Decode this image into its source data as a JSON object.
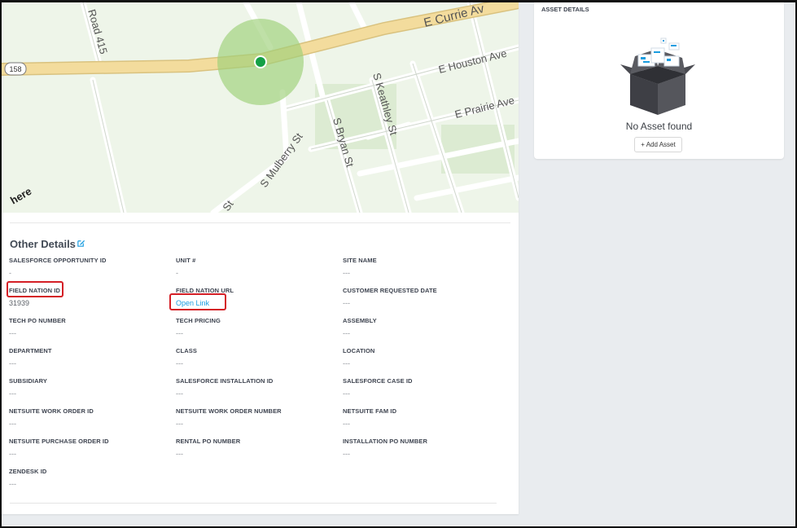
{
  "map": {
    "streets": {
      "e_currie": "E Currie Av",
      "e_houston": "E Houston Ave",
      "e_prairie": "E Prairie Ave",
      "s_keathley": "S Keathley St",
      "s_bryan": "S Bryan St",
      "s_mulberry": "S Mulberry St",
      "road_415": "Road 415",
      "route_158": "158",
      "st_fragment": "St"
    },
    "logo": "here",
    "colors": {
      "highway": "#f3dc9d",
      "radius": "#9ccf78",
      "marker": "#14a046",
      "land": "#eef5e9"
    }
  },
  "other_details": {
    "title": "Other Details",
    "fields": [
      {
        "label": "SALESFORCE OPPORTUNITY ID",
        "value": "-"
      },
      {
        "label": "UNIT #",
        "value": "-"
      },
      {
        "label": "SITE NAME",
        "value": "---"
      },
      {
        "label": "FIELD NATION ID",
        "value": "31939"
      },
      {
        "label": "FIELD NATION URL",
        "value": "Open Link"
      },
      {
        "label": "CUSTOMER REQUESTED DATE",
        "value": "---"
      },
      {
        "label": "TECH PO NUMBER",
        "value": "---"
      },
      {
        "label": "TECH PRICING",
        "value": "---"
      },
      {
        "label": "ASSEMBLY",
        "value": "---"
      },
      {
        "label": "DEPARTMENT",
        "value": "---"
      },
      {
        "label": "CLASS",
        "value": "---"
      },
      {
        "label": "LOCATION",
        "value": "---"
      },
      {
        "label": "SUBSIDIARY",
        "value": "---"
      },
      {
        "label": "SALESFORCE INSTALLATION ID",
        "value": "---"
      },
      {
        "label": "SALESFORCE CASE ID",
        "value": "---"
      },
      {
        "label": "NETSUITE WORK ORDER ID",
        "value": "---"
      },
      {
        "label": "NETSUITE WORK ORDER NUMBER",
        "value": "---"
      },
      {
        "label": "NETSUITE FAM ID",
        "value": "---"
      },
      {
        "label": "NETSUITE PURCHASE ORDER ID",
        "value": "---"
      },
      {
        "label": "RENTAL PO NUMBER",
        "value": "---"
      },
      {
        "label": "INSTALLATION PO NUMBER",
        "value": "---"
      },
      {
        "label": "ZENDESK ID",
        "value": "---"
      }
    ]
  },
  "asset_details": {
    "title": "ASSET DETAILS",
    "empty_text": "No Asset found",
    "add_button": "+ Add Asset"
  },
  "colors": {
    "link": "#1a9de0",
    "highlight": "#d41f26"
  }
}
